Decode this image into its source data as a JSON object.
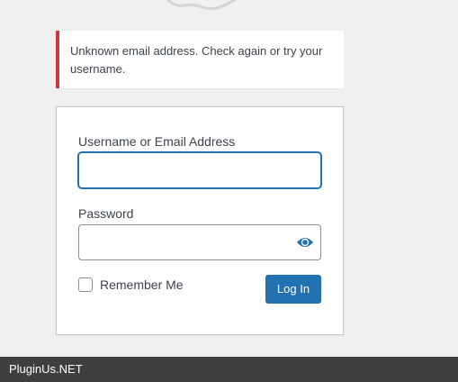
{
  "notice": {
    "message": "Unknown email address. Check again or try your username."
  },
  "login_form": {
    "username_label": "Username or Email Address",
    "username_value": "",
    "password_label": "Password",
    "password_value": "",
    "remember_label": "Remember Me",
    "remember_checked": false,
    "submit_label": "Log In"
  },
  "footer": {
    "brand": "PluginUs.NET"
  },
  "icons": {
    "show_password": "eye-icon"
  },
  "colors": {
    "background": "#f0f0f1",
    "error_accent": "#d63638",
    "primary": "#2271b1",
    "footer_bg": "#3f3f3f"
  }
}
